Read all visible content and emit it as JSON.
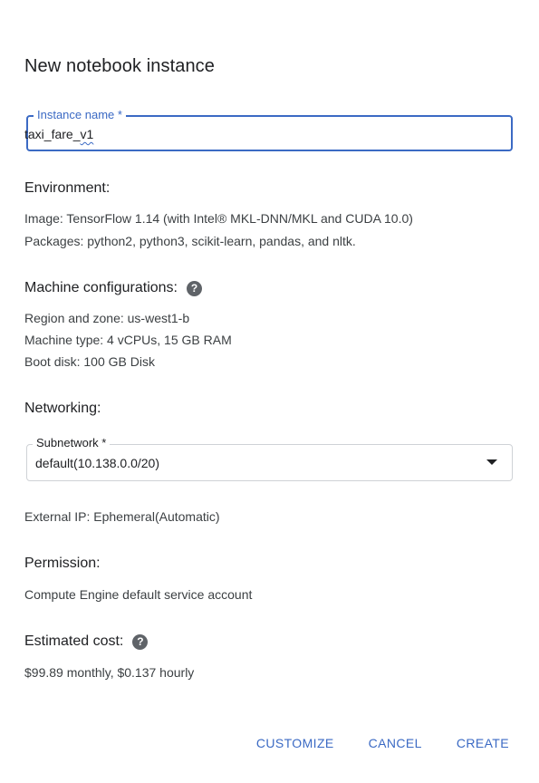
{
  "dialog": {
    "title": "New notebook instance"
  },
  "instance_name": {
    "label": "Instance name *",
    "value": "taxi_fare_v1",
    "value_prefix": "taxi_fare_",
    "value_flagged": "v1"
  },
  "environment": {
    "heading": "Environment:",
    "image": "Image: TensorFlow 1.14 (with Intel® MKL-DNN/MKL and CUDA 10.0)",
    "packages": "Packages: python2, python3, scikit-learn, pandas, and nltk."
  },
  "machine": {
    "heading": "Machine configurations:",
    "help_icon": "help-circle-icon",
    "region": "Region and zone: us-west1-b",
    "machine_type": "Machine type: 4 vCPUs, 15 GB RAM",
    "boot_disk": "Boot disk: 100 GB Disk"
  },
  "networking": {
    "heading": "Networking:",
    "subnetwork_label": "Subnetwork *",
    "subnetwork_value": "default(10.138.0.0/20)",
    "external_ip": "External IP: Ephemeral(Automatic)"
  },
  "permission": {
    "heading": "Permission:",
    "value": "Compute Engine default service account"
  },
  "cost": {
    "heading": "Estimated cost:",
    "help_icon": "help-circle-icon",
    "value": "$99.89 monthly, $0.137 hourly"
  },
  "actions": {
    "customize": "CUSTOMIZE",
    "cancel": "CANCEL",
    "create": "CREATE"
  },
  "colors": {
    "accent": "#3b6ac4",
    "text": "#202124",
    "secondary_text": "#3c4043",
    "icon": "#5f6368"
  }
}
